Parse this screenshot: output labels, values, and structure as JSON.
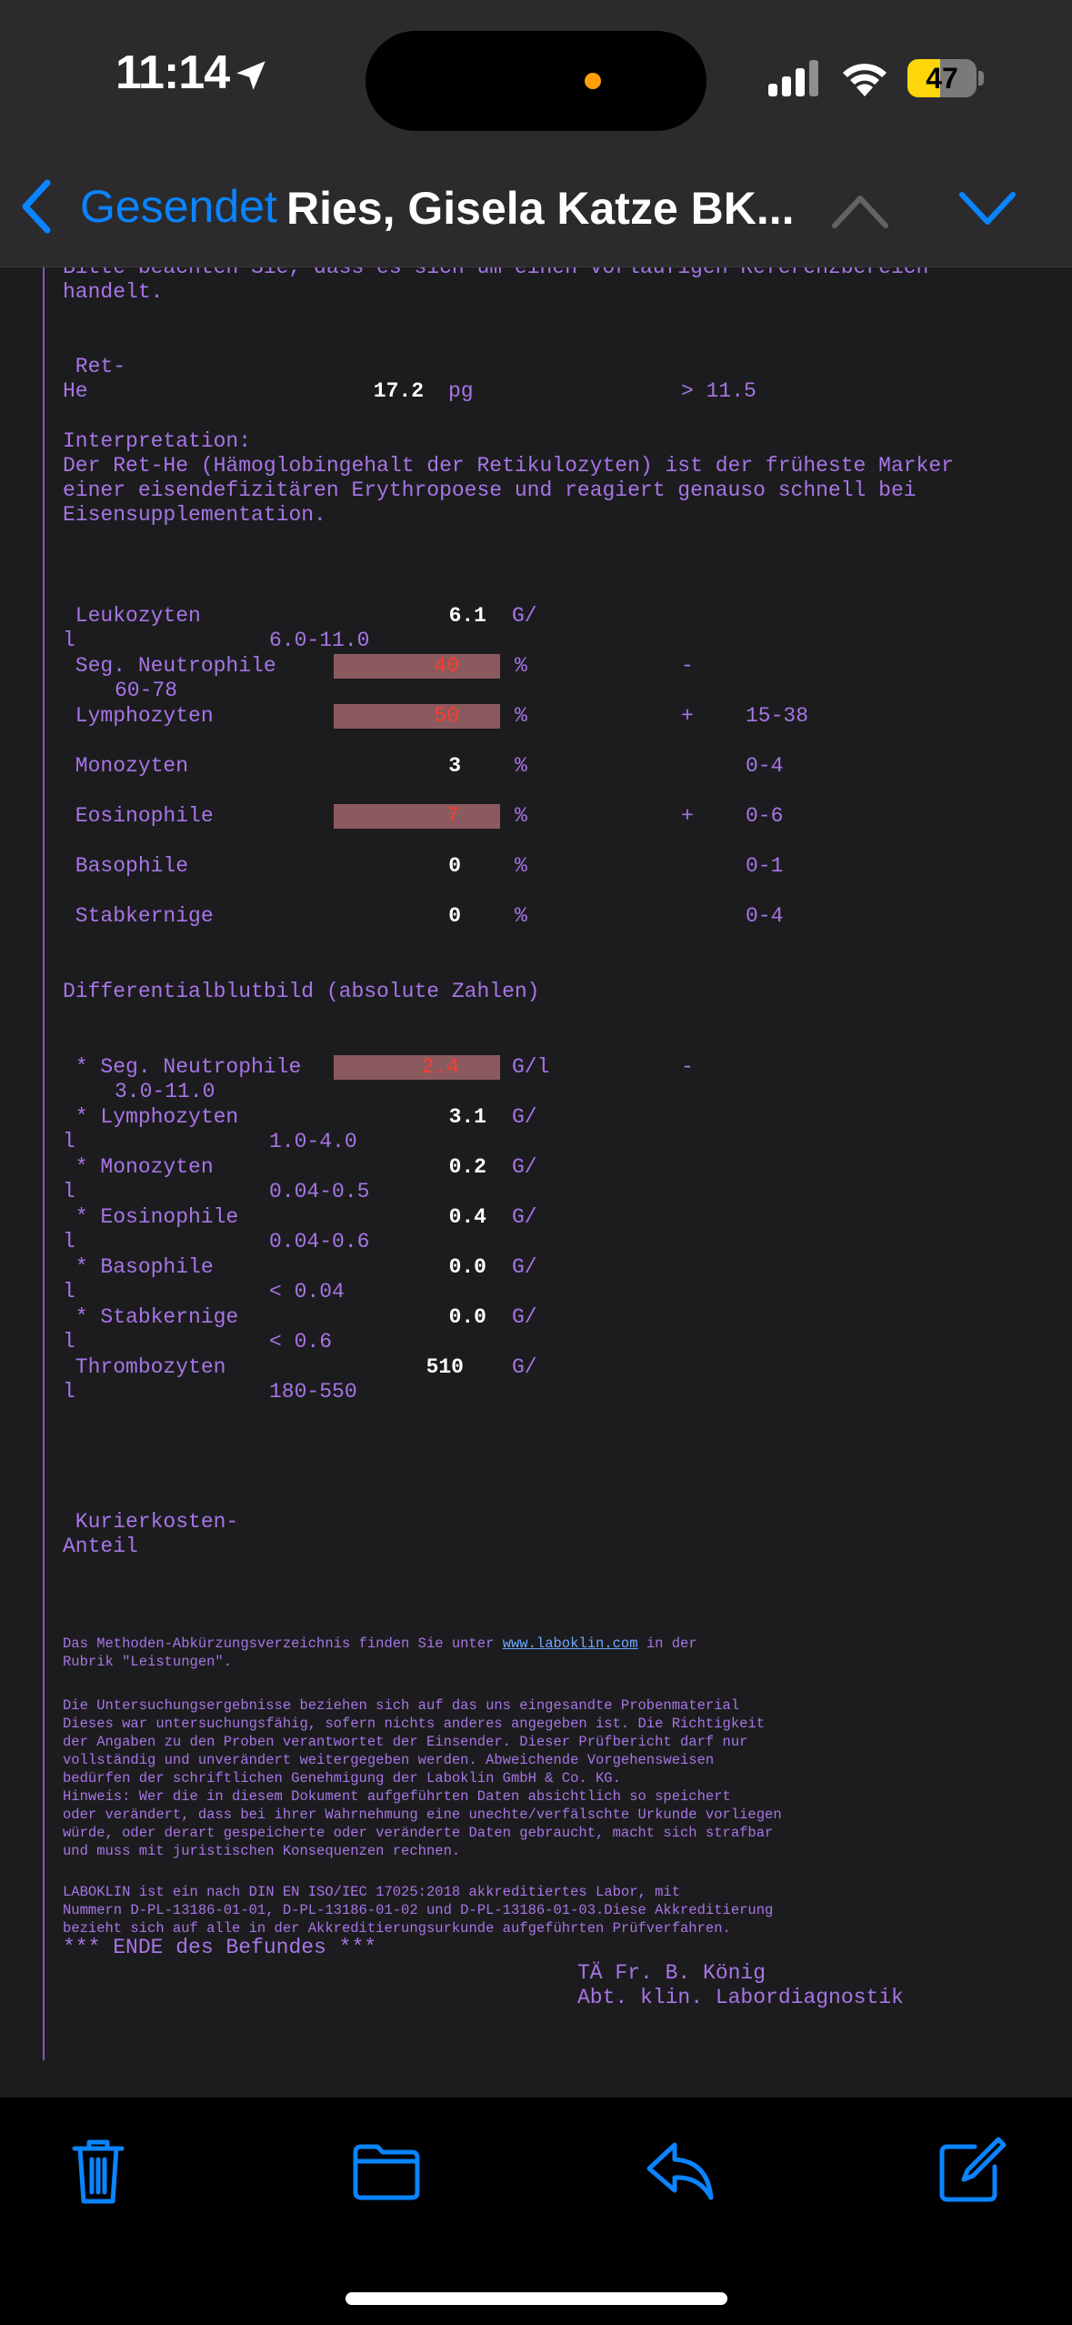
{
  "status": {
    "time": "11:14",
    "battery": "47",
    "battery_level": 0.47
  },
  "nav": {
    "back_label": "Gesendet",
    "title": "Ries, Gisela Katze BK..."
  },
  "report": {
    "intro_cut": "Bitte beachten Sie, dass es sich um einen vorläufigen Referenzbereich",
    "intro_end": "handelt.",
    "rethe": {
      "l1": " Ret-",
      "l2": "He",
      "value": "17.2",
      "unit": "pg",
      "ref": "> 11.5"
    },
    "interp_title": "Interpretation:",
    "interp_lines": [
      "Der Ret-He (Hämoglobingehalt der Retikulozyten) ist der früheste Marker",
      "einer eisendefizitären Erythropoese und reagiert genauso schnell bei",
      "Eisensupplementation."
    ],
    "leuko": {
      "name": " Leukozyten",
      "value": "6.1",
      "unit": "G/",
      "l": "l",
      "ref": "6.0-11.0"
    },
    "seg": {
      "name": " Seg. Neutrophile",
      "value": "40",
      "unit": "%",
      "flag": "-",
      "ref": "60-78"
    },
    "lympho": {
      "name": " Lymphozyten",
      "value": "50",
      "unit": "%",
      "flag": "+",
      "ref": "15-38"
    },
    "mono": {
      "name": " Monozyten",
      "value": "3",
      "unit": "%",
      "ref": "0-4"
    },
    "eos": {
      "name": " Eosinophile",
      "value": "7",
      "unit": "%",
      "flag": "+",
      "ref": "0-6"
    },
    "baso": {
      "name": " Basophile",
      "value": "0",
      "unit": "%",
      "ref": "0-1"
    },
    "stab": {
      "name": " Stabkernige",
      "value": "0",
      "unit": "%",
      "ref": "0-4"
    },
    "diff_title": "Differentialblutbild (absolute Zahlen)",
    "aseg": {
      "name": " * Seg. Neutrophile",
      "value": "2.4",
      "unit": "G/l",
      "flag": "-",
      "ref": "3.0-11.0"
    },
    "alym": {
      "name": " * Lymphozyten",
      "value": "3.1",
      "unit": "G/",
      "l": "l",
      "ref": "1.0-4.0"
    },
    "amono": {
      "name": " * Monozyten",
      "value": "0.2",
      "unit": "G/",
      "l": "l",
      "ref": "0.04-0.5"
    },
    "aeos": {
      "name": " * Eosinophile",
      "value": "0.4",
      "unit": "G/",
      "l": "l",
      "ref": "0.04-0.6"
    },
    "abaso": {
      "name": " * Basophile",
      "value": "0.0",
      "unit": "G/",
      "l": "l",
      "ref": "< 0.04"
    },
    "astab": {
      "name": " * Stabkernige",
      "value": "0.0",
      "unit": "G/",
      "l": "l",
      "ref": "< 0.6"
    },
    "thrombo": {
      "name": " Thrombozyten",
      "value": "510",
      "unit": "G/",
      "l": "l",
      "ref": "180-550"
    },
    "kurier_l1": " Kurierkosten-",
    "kurier_l2": "Anteil",
    "method_pre": "Das Methoden-Abkürzungsverzeichnis finden Sie unter ",
    "method_link": "www.laboklin.com",
    "method_post": " in der",
    "method_line2": "Rubrik \"Leistungen\".",
    "disclaimer": [
      "Die Untersuchungsergebnisse beziehen sich auf das uns eingesandte Probenmaterial",
      "Dieses war untersuchungsfähig, sofern nichts anderes angegeben ist. Die Richtigkeit",
      "der Angaben zu den Proben verantwortet der Einsender. Dieser Prüfbericht darf nur",
      "vollständig und unverändert weitergegeben werden. Abweichende Vorgehensweisen",
      "bedürfen der schriftlichen Genehmigung der Laboklin GmbH & Co. KG.",
      "Hinweis: Wer die in diesem Dokument aufgeführten Daten absichtlich so speichert",
      "oder verändert, dass bei ihrer Wahrnehmung eine unechte/verfälschte Urkunde vorliegen",
      "würde, oder derart gespeicherte oder veränderte Daten gebraucht, macht sich strafbar",
      "und muss mit juristischen Konsequenzen rechnen."
    ],
    "accred": [
      "LABOKLIN ist ein nach DIN EN ISO/IEC 17025:2018 akkreditiertes Labor, mit",
      "Nummern D-PL-13186-01-01, D-PL-13186-01-02 und D-PL-13186-01-03.Diese Akkreditierung",
      "bezieht sich auf alle in der Akkreditierungsurkunde aufgeführten Prüfverfahren."
    ],
    "end": "*** ENDE des Befundes ***",
    "sign1": "TÄ Fr. B. König",
    "sign2": "Abt. klin. Labordiagnostik"
  },
  "toolbar": {
    "icons": [
      "trash-icon",
      "folder-icon",
      "reply-icon",
      "compose-icon"
    ],
    "accent": "#0a84ff"
  }
}
